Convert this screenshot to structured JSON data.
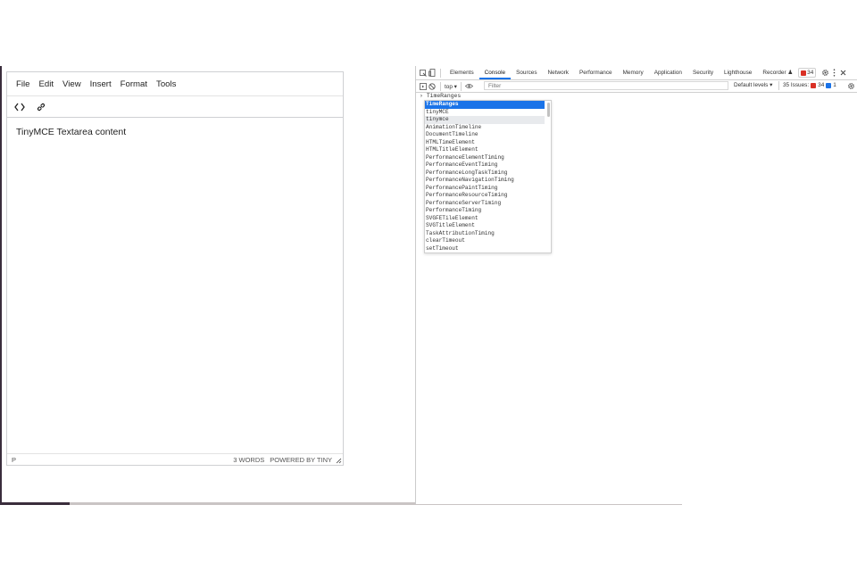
{
  "editor": {
    "menu": [
      "File",
      "Edit",
      "View",
      "Insert",
      "Format",
      "Tools"
    ],
    "toolbar": {
      "source_icon": "code-icon",
      "link_icon": "link-icon"
    },
    "content": "TinyMCE Textarea content",
    "status_path": "P",
    "word_count": "3 WORDS",
    "powered_by": "POWERED BY TINY"
  },
  "devtools": {
    "tabs": [
      "Elements",
      "Console",
      "Sources",
      "Network",
      "Performance",
      "Memory",
      "Application",
      "Security",
      "Lighthouse",
      "Recorder"
    ],
    "active_tab": "Console",
    "error_count": "34",
    "context": "top ▾",
    "filter_placeholder": "Filter",
    "levels": "Default levels ▾",
    "issues": {
      "label": "35 Issues:",
      "errors": "34",
      "info": "1"
    },
    "prompt_text": "TimeRanges",
    "autocomplete": [
      "TimeRanges",
      "tinyMCE",
      "tinymce",
      "AnimationTimeline",
      "DocumentTimeline",
      "HTMLTimeElement",
      "HTMLTitleElement",
      "PerformanceElementTiming",
      "PerformanceEventTiming",
      "PerformanceLongTaskTiming",
      "PerformanceNavigationTiming",
      "PerformancePaintTiming",
      "PerformanceResourceTiming",
      "PerformanceServerTiming",
      "PerformanceTiming",
      "SVGFETileElement",
      "SVGTitleElement",
      "TaskAttributionTiming",
      "clearTimeout",
      "setTimeout"
    ],
    "colors": {
      "accent": "#1a73e8",
      "error": "#d93025"
    }
  }
}
